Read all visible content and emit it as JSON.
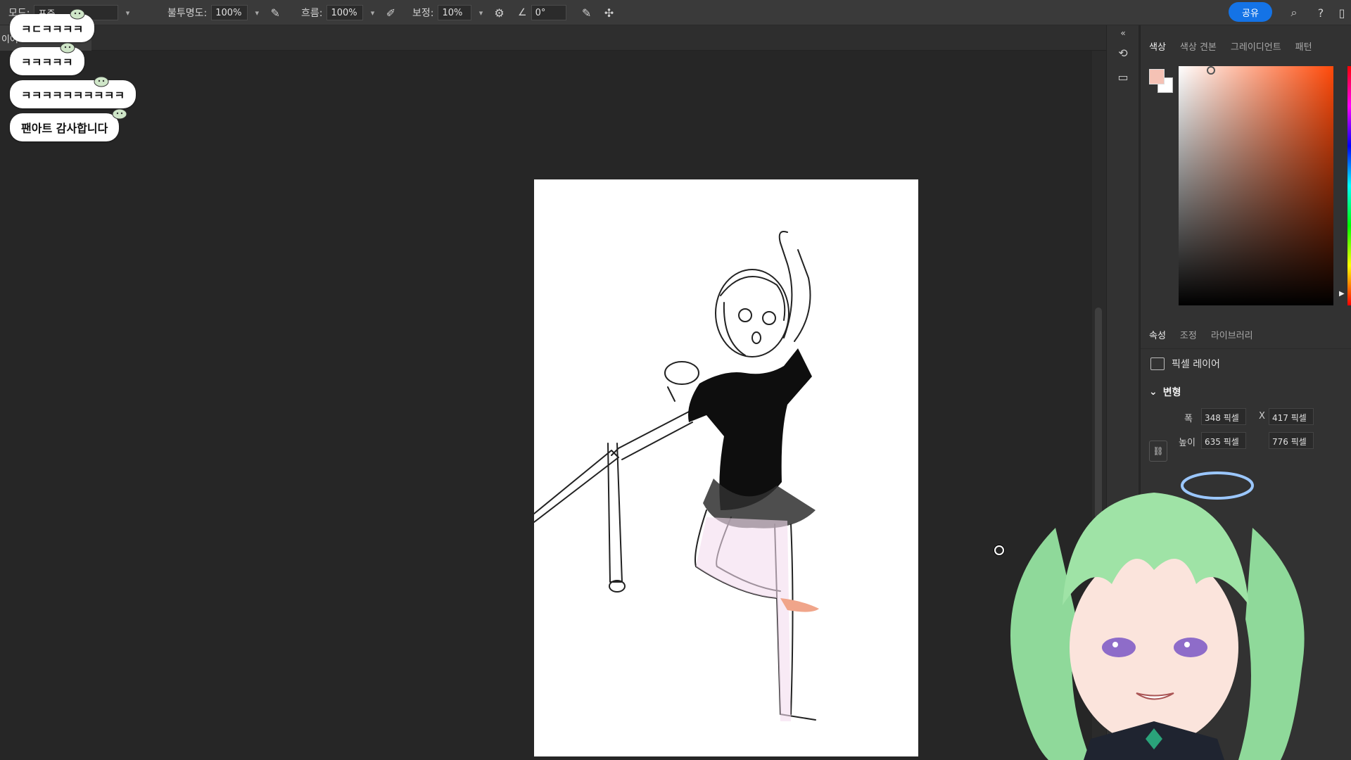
{
  "optbar": {
    "mode_label": "모드:",
    "mode_value": "표준",
    "opacity_label": "불투명도:",
    "opacity_value": "100%",
    "flow_label": "흐름:",
    "flow_value": "100%",
    "smoothing_label": "보정:",
    "smoothing_value": "10%",
    "angle_value": "0°",
    "share_label": "공유"
  },
  "doc_tab": {
    "label": "이어"
  },
  "chat": [
    {
      "text": "ㅋㄷㅋㅋㅋㅋ"
    },
    {
      "text": "ㅋㅋㅋㅋㅋ"
    },
    {
      "text": "ㅋㅋㅋㅋㅋㅋㅋㅋㅋㅋ"
    },
    {
      "text": "팬아트 감사합니다"
    }
  ],
  "color_panel": {
    "tabs": [
      "색상",
      "색상 견본",
      "그레이디언트",
      "패턴"
    ],
    "active_tab": "색상",
    "foreground": "#f5c2b5",
    "background": "#ffffff",
    "hue_color": "#ff4a0a"
  },
  "props_panel": {
    "tabs": [
      "속성",
      "조정",
      "라이브러리"
    ],
    "active_tab": "속성",
    "layer_kind": "픽셀 레이어",
    "section": "변형",
    "width_label": "폭",
    "width_value": "348 픽셀",
    "x_label": "X",
    "x_value": "417 픽셀",
    "height_label": "높이",
    "height_value": "635 픽셀",
    "y_value": "776 픽셀"
  },
  "colors": {
    "accent": "#1473e6",
    "panel": "#323232",
    "canvas_bg": "#262626"
  }
}
